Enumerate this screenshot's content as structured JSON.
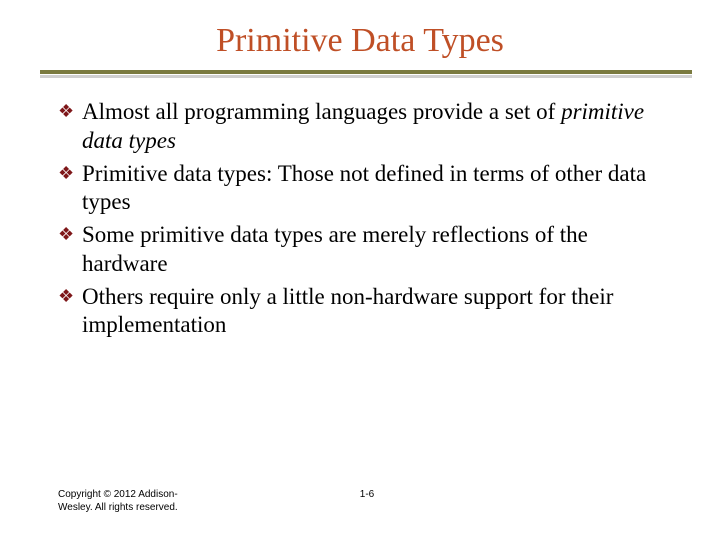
{
  "title": "Primitive Data Types",
  "bullets": [
    {
      "pre": "Almost all programming languages provide a set of ",
      "em": "primitive data types",
      "post": ""
    },
    {
      "pre": "Primitive data types: Those not defined in terms of other data types",
      "em": "",
      "post": ""
    },
    {
      "pre": "Some primitive data types are merely reflections of the hardware",
      "em": "",
      "post": ""
    },
    {
      "pre": "Others require only a little non-hardware support for their implementation",
      "em": "",
      "post": ""
    }
  ],
  "footer": {
    "copyright": "Copyright © 2012 Addison-Wesley. All rights reserved.",
    "page": "1-6"
  }
}
